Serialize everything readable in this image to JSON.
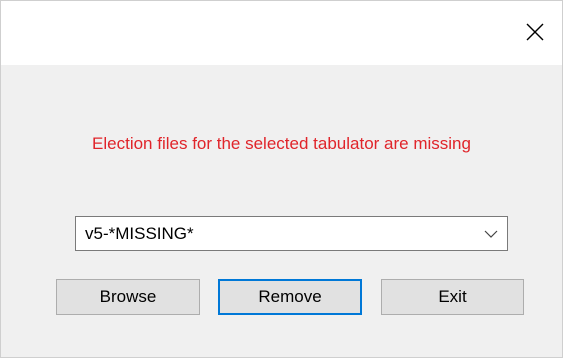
{
  "dialog": {
    "close_icon": "close-icon",
    "message": "Election files for the selected tabulator are missing",
    "message_color": "#e0242a",
    "focus_color": "#0078d7"
  },
  "dropdown": {
    "selected_value": "v5-*MISSING*",
    "arrow_icon": "chevron-down-icon"
  },
  "buttons": {
    "browse_label": "Browse",
    "remove_label": "Remove",
    "exit_label": "Exit"
  }
}
